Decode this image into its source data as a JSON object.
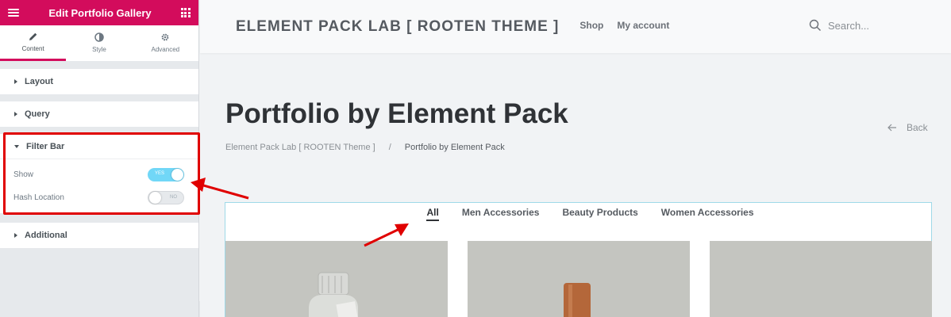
{
  "panel": {
    "title": "Edit Portfolio Gallery",
    "tabs": [
      {
        "label": "Content",
        "icon": "pencil-icon",
        "active": true
      },
      {
        "label": "Style",
        "icon": "contrast-icon",
        "active": false
      },
      {
        "label": "Advanced",
        "icon": "gear-icon",
        "active": false
      }
    ],
    "sections": {
      "layout": "Layout",
      "query": "Query",
      "filter_bar": "Filter Bar",
      "additional": "Additional"
    },
    "controls": {
      "show_label": "Show",
      "show_state": "YES",
      "hash_label": "Hash Location",
      "hash_state": "NO"
    },
    "accent": "#d30c5c"
  },
  "site": {
    "brand": "ELEMENT PACK LAB [ ROOTEN THEME ]",
    "nav": [
      "Shop",
      "My account"
    ],
    "search_placeholder": "Search...",
    "page_title": "Portfolio by Element Pack",
    "breadcrumb": [
      "Element Pack Lab [ ROOTEN Theme ]",
      "/",
      "Portfolio by Element Pack"
    ],
    "back_label": "Back",
    "filters": [
      "All",
      "Men Accessories",
      "Beauty Products",
      "Women Accessories"
    ],
    "active_filter": "All"
  }
}
